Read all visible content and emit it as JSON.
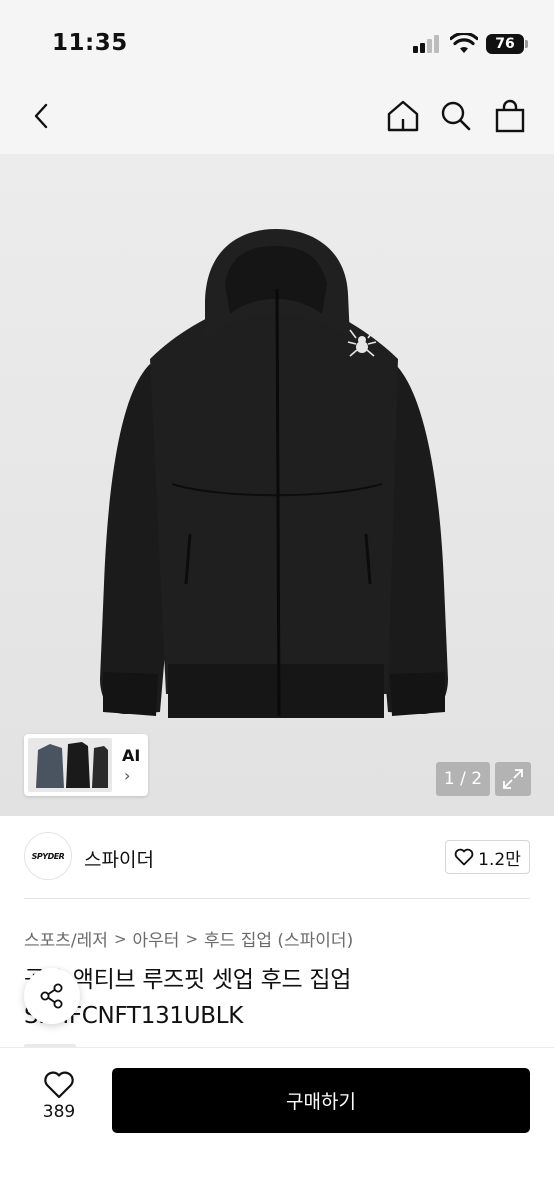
{
  "status_bar": {
    "time": "11:35",
    "battery": "76"
  },
  "nav": {
    "icons": [
      "chevron-left-icon",
      "home-icon",
      "search-icon",
      "shopping-bag-icon"
    ]
  },
  "gallery": {
    "ai_label": "AI",
    "ai_chevron": "›",
    "page_indicator": "1 / 2",
    "image_count": 2,
    "current_image": 1
  },
  "brand": {
    "logo_text": "SPYDER",
    "name": "스파이더",
    "like_count": "1.2만"
  },
  "breadcrumb": {
    "items": [
      "스포츠/레저",
      "아우터",
      "후드 집업 (스파이더)"
    ],
    "separator": ">"
  },
  "product": {
    "title": "공용 액티브 루즈핏 셋업 후드 집업 SPHFCNFT131UBLK"
  },
  "bottom_bar": {
    "wish_count": "389",
    "buy_label": "구매하기"
  },
  "colors": {
    "brand_black": "#000000",
    "text_secondary": "#6b6b6b",
    "background_gray": "#f5f5f5"
  }
}
